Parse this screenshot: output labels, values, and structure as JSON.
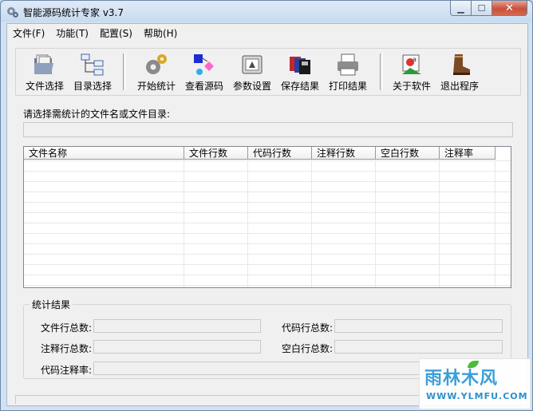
{
  "window": {
    "title": "智能源码统计专家 v3.7"
  },
  "menu": [
    {
      "label": "文件(F)"
    },
    {
      "label": "功能(T)"
    },
    {
      "label": "配置(S)"
    },
    {
      "label": "帮助(H)"
    }
  ],
  "toolbar": [
    {
      "label": "文件选择",
      "icon": "folder-open-icon"
    },
    {
      "label": "目录选择",
      "icon": "tree-icon"
    },
    {
      "label": "开始统计",
      "icon": "gears-icon"
    },
    {
      "label": "查看源码",
      "icon": "shapes-icon"
    },
    {
      "label": "参数设置",
      "icon": "settings-icon"
    },
    {
      "label": "保存结果",
      "icon": "floppy-disks-icon"
    },
    {
      "label": "打印结果",
      "icon": "printer-icon"
    },
    {
      "label": "关于软件",
      "icon": "about-icon"
    },
    {
      "label": "退出程序",
      "icon": "exit-boot-icon"
    }
  ],
  "selection": {
    "prompt": "请选择需统计的文件名或文件目录:",
    "path_value": ""
  },
  "table": {
    "columns": [
      "文件名称",
      "文件行数",
      "代码行数",
      "注释行数",
      "空白行数",
      "注释率"
    ],
    "rows": []
  },
  "stats": {
    "title": "统计结果",
    "total_file_lines_label": "文件行总数:",
    "total_code_lines_label": "代码行总数:",
    "total_comment_lines_label": "注释行总数:",
    "total_blank_lines_label": "空白行总数:",
    "code_comment_ratio_label": "代码注释率:",
    "total_file_lines": "",
    "total_code_lines": "",
    "total_comment_lines": "",
    "total_blank_lines": "",
    "code_comment_ratio": ""
  },
  "watermark": {
    "brand": "雨林木风",
    "url": "WWW.YLMFU.COM"
  }
}
